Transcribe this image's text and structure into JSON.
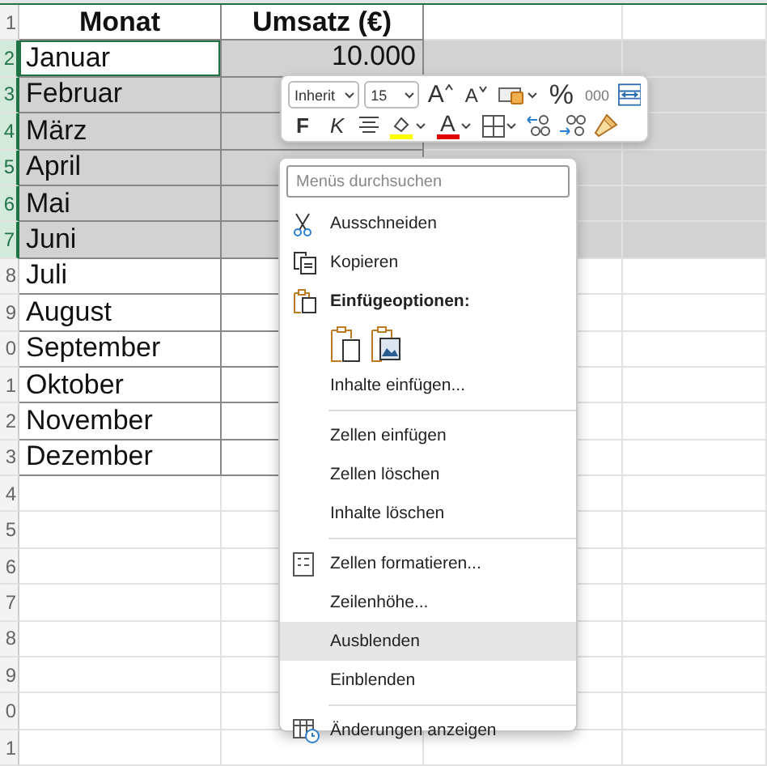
{
  "row_headers": [
    {
      "label": "1",
      "selected": false
    },
    {
      "label": "2",
      "selected": true
    },
    {
      "label": "3",
      "selected": true
    },
    {
      "label": "4",
      "selected": true
    },
    {
      "label": "5",
      "selected": true
    },
    {
      "label": "6",
      "selected": true
    },
    {
      "label": "7",
      "selected": true
    },
    {
      "label": "8",
      "selected": false
    },
    {
      "label": "9",
      "selected": false
    },
    {
      "label": "0",
      "selected": false
    },
    {
      "label": "1",
      "selected": false
    },
    {
      "label": "2",
      "selected": false
    },
    {
      "label": "3",
      "selected": false
    },
    {
      "label": "4",
      "selected": false
    },
    {
      "label": "5",
      "selected": false
    },
    {
      "label": "6",
      "selected": false
    },
    {
      "label": "7",
      "selected": false
    },
    {
      "label": "8",
      "selected": false
    },
    {
      "label": "9",
      "selected": false
    },
    {
      "label": "0",
      "selected": false
    },
    {
      "label": "1",
      "selected": false
    }
  ],
  "table_header": [
    "Monat",
    "Umsatz (€)"
  ],
  "rows": [
    {
      "month": "Januar",
      "value": "10.000",
      "selected": true,
      "active": true
    },
    {
      "month": "Februar",
      "selected": true,
      "active": false
    },
    {
      "month": "März",
      "selected": true,
      "active": false
    },
    {
      "month": "April",
      "selected": true,
      "active": false
    },
    {
      "month": "Mai",
      "selected": true,
      "active": false
    },
    {
      "month": "Juni",
      "selected": true,
      "active": false
    },
    {
      "month": "Juli",
      "selected": false,
      "active": false
    },
    {
      "month": "August",
      "selected": false,
      "active": false
    },
    {
      "month": "September",
      "selected": false,
      "active": false
    },
    {
      "month": "Oktober",
      "selected": false,
      "active": false
    },
    {
      "month": "November",
      "selected": false,
      "active": false
    },
    {
      "month": "Dezember",
      "selected": false,
      "active": false
    }
  ],
  "toolbar": {
    "font": "Inherit",
    "size": "15",
    "row_1": [
      {
        "kind": "grow",
        "label": "A"
      },
      {
        "kind": "shrink",
        "label": "A"
      },
      {
        "kind": "cellstyle"
      },
      {
        "kind": "text",
        "label": "%"
      },
      {
        "kind": "small",
        "label": "000"
      },
      {
        "kind": "merge"
      }
    ],
    "row_2": [
      {
        "kind": "bold",
        "label": "F"
      },
      {
        "kind": "italic",
        "label": "K"
      },
      {
        "kind": "align"
      },
      {
        "kind": "fill"
      },
      {
        "kind": "fontcolor",
        "label": "A"
      },
      {
        "kind": "borders"
      },
      {
        "kind": "decdec"
      },
      {
        "kind": "incdec"
      },
      {
        "kind": "painter"
      }
    ]
  },
  "context_menu": {
    "search": {
      "placeholder": "Menüs durchsuchen"
    },
    "items": [
      {
        "kind": "cut",
        "label": "Ausschneiden",
        "selected": false
      },
      {
        "kind": "copy",
        "label": "Kopieren",
        "selected": false
      },
      {
        "kind": "header",
        "label": "Einfügeoptionen:"
      },
      {
        "kind": "paste_options"
      },
      {
        "kind": "item",
        "label": "Inhalte einfügen...",
        "selected": false
      },
      {
        "kind": "separator"
      },
      {
        "kind": "item",
        "label": "Zellen einfügen",
        "selected": false
      },
      {
        "kind": "item",
        "label": "Zellen löschen",
        "selected": false
      },
      {
        "kind": "item",
        "label": "Inhalte löschen",
        "selected": false
      },
      {
        "kind": "separator"
      },
      {
        "kind": "format",
        "label": "Zellen formatieren...",
        "selected": false
      },
      {
        "kind": "item",
        "label": "Zeilenhöhe...",
        "selected": false
      },
      {
        "kind": "item",
        "label": "Ausblenden",
        "selected": true
      },
      {
        "kind": "item",
        "label": "Einblenden",
        "selected": false
      },
      {
        "kind": "separator"
      },
      {
        "kind": "changes",
        "label": "Änderungen anzeigen",
        "selected": false
      }
    ]
  }
}
